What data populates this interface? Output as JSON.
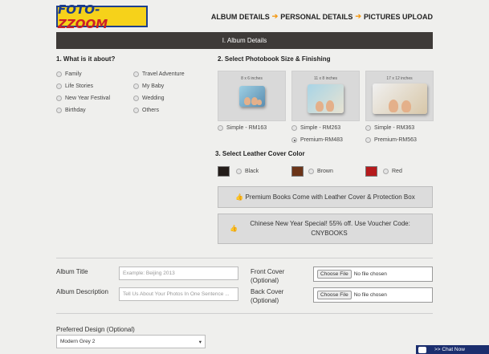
{
  "logo": {
    "part1": "FOTO-",
    "part2": "ZZOOM"
  },
  "steps": [
    "ALBUM DETAILS",
    "PERSONAL DETAILS",
    "PICTURES UPLOAD"
  ],
  "section_bar": "I. Album Details",
  "q1": {
    "title": "1. What is it about?",
    "options": [
      "Family",
      "Travel Adventure",
      "Life Stories",
      "My Baby",
      "New Year Festival",
      "Wedding",
      "Birthday",
      "Others"
    ]
  },
  "q2": {
    "title": "2. Select Photobook Size & Finishing",
    "sizes": [
      {
        "label": "8 x 6 inches",
        "simple": "Simple - RM163"
      },
      {
        "label": "11 x 8 inches",
        "simple": "Simple - RM263",
        "premium": "Premium-RM483"
      },
      {
        "label": "17 x 12 inches",
        "simple": "Simple - RM363",
        "premium": "Premium-RM563"
      }
    ],
    "selected": "Premium-RM483"
  },
  "q3": {
    "title": "3. Select Leather Cover Color",
    "colors": [
      {
        "name": "Black",
        "hex": "#231c19"
      },
      {
        "name": "Brown",
        "hex": "#6b3418"
      },
      {
        "name": "Red",
        "hex": "#b51a1c"
      }
    ]
  },
  "promos": [
    " Premium Books Come with Leather Cover & Protection Box",
    " Chinese New Year Special! 55% off. Use Voucher Code: CNYBOOKS"
  ],
  "form": {
    "album_title_label": "Album Title",
    "album_title_placeholder": "Example: Beijing 2013",
    "album_desc_label": "Album Description",
    "album_desc_placeholder": "Tell Us About Your Photos In One Sentence ...",
    "front_cover_label": "Front Cover\n(Optional)",
    "back_cover_label": "Back Cover\n(Optional)",
    "choose_file": "Choose File",
    "no_file": "No file chosen",
    "design_label": "Preferred Design (Optional)",
    "design_value": "Modern Grey 2"
  },
  "chat": ">> Chat Now"
}
